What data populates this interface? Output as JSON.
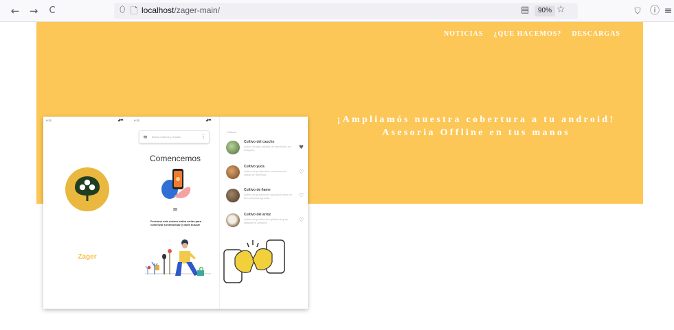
{
  "browser": {
    "back_icon": "←",
    "forward_icon": "→",
    "reload_icon": "C",
    "shield_icon": "⬯",
    "page_icon": "🗋",
    "url_host": "localhost",
    "url_path": "/zager-main/",
    "reader_icon": "▤",
    "zoom": "90%",
    "star_icon": "☆",
    "pocket_icon": "⛉",
    "account_icon": "ⓘ",
    "menu_icon": "≡"
  },
  "nav": {
    "items": [
      "NOTICIAS",
      "¿QUE HACEMOS?",
      "DESCARGAS"
    ]
  },
  "hero": {
    "line1": "¡Ampliamós nuestra cobertura a tu android!",
    "line2": "Asesoria Offline en tus manos",
    "bg_color": "#fcc757"
  },
  "app": {
    "splash": {
      "brand": "Zager"
    },
    "main": {
      "search_placeholder": "Busca cultivos y modos",
      "title": "Comencemos",
      "instructions": "Presiona este mismo botón arriba para comenzar a interactuar y darle buscar"
    },
    "list": {
      "header": "Cultivos",
      "items": [
        {
          "title": "Cultivo del caucho",
          "desc": "cultivo de alta calidad de desarrollo en bosques",
          "fav": "♥"
        },
        {
          "title": "Cultivo yuca",
          "desc": "cultivo de producción comúnmente usado en terrenos",
          "fav": "♡"
        },
        {
          "title": "Cultivo de ñame",
          "desc": "cultivo de producción popular bueno en la economía agrícola",
          "fav": "♡"
        },
        {
          "title": "Cultivo del arroz",
          "desc": "cultivo de producción global de gran utilidad en campos",
          "fav": "♡"
        }
      ]
    }
  }
}
